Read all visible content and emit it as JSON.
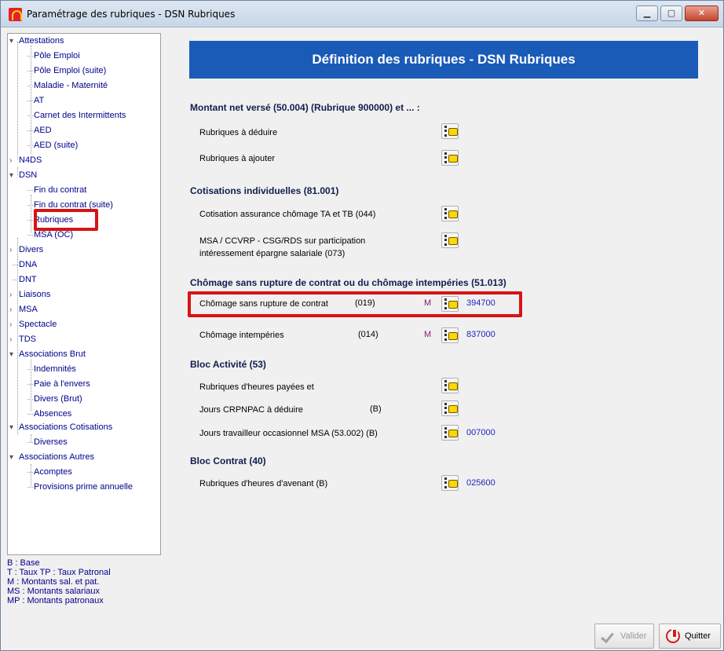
{
  "window": {
    "title": "Paramétrage des rubriques - DSN Rubriques",
    "min_icon": "minimize-icon",
    "max_icon": "maximize-icon",
    "close_icon": "close-icon"
  },
  "tree": {
    "items": [
      {
        "label": "Attestations",
        "toggle": "▾"
      },
      {
        "label": "Pôle Emploi"
      },
      {
        "label": "Pôle Emploi (suite)"
      },
      {
        "label": "Maladie - Maternité"
      },
      {
        "label": "AT"
      },
      {
        "label": "Carnet des Intermittents"
      },
      {
        "label": "AED"
      },
      {
        "label": "AED (suite)"
      },
      {
        "label": "N4DS",
        "toggle": "›"
      },
      {
        "label": "DSN",
        "toggle": "▾"
      },
      {
        "label": "Fin du contrat"
      },
      {
        "label": "Fin du contrat (suite)"
      },
      {
        "label": "Rubriques"
      },
      {
        "label": "MSA (OC)"
      },
      {
        "label": "Divers",
        "toggle": "›"
      },
      {
        "label": "DNA"
      },
      {
        "label": "DNT"
      },
      {
        "label": "Liaisons",
        "toggle": "›"
      },
      {
        "label": "MSA",
        "toggle": "›"
      },
      {
        "label": "Spectacle",
        "toggle": "›"
      },
      {
        "label": "TDS",
        "toggle": "›"
      },
      {
        "label": "Associations Brut",
        "toggle": "▾"
      },
      {
        "label": "Indemnités"
      },
      {
        "label": "Paie à l'envers"
      },
      {
        "label": "Divers (Brut)"
      },
      {
        "label": "Absences"
      },
      {
        "label": "Associations Cotisations",
        "toggle": "▾"
      },
      {
        "label": "Diverses"
      },
      {
        "label": "Associations Autres",
        "toggle": "▾"
      },
      {
        "label": "Acomptes"
      },
      {
        "label": "Provisions prime annuelle"
      }
    ]
  },
  "legend": [
    "B   : Base",
    "T   : Taux   TP : Taux Patronal",
    "M  : Montants sal. et pat.",
    "MS : Montants salariaux",
    "MP : Montants patronaux"
  ],
  "main": {
    "banner": "Définition des rubriques - DSN Rubriques",
    "sections": [
      {
        "title": "Montant net versé (50.004) (Rubrique 900000) et ... :"
      },
      {
        "title": "Cotisations individuelles (81.001)"
      },
      {
        "title": "Chômage sans rupture de contrat ou du chômage intempéries (51.013)"
      },
      {
        "title": "Bloc Activité (53)"
      },
      {
        "title": "Bloc Contrat (40)"
      }
    ],
    "rows": [
      {
        "label": "Rubriques à déduire"
      },
      {
        "label": "Rubriques à ajouter"
      },
      {
        "label": "Cotisation assurance chômage TA et TB (044)"
      },
      {
        "label": "MSA / CCVRP - CSG/RDS sur participation",
        "label2": "intéressement épargne salariale (073)"
      },
      {
        "label": "Chômage sans rupture de contrat",
        "code": "(019)",
        "flag": "M",
        "value": "394700"
      },
      {
        "label": "Chômage intempéries",
        "code": "(014)",
        "flag": "M",
        "value": "837000"
      },
      {
        "label": "Rubriques d'heures payées et"
      },
      {
        "label": "Jours CRPNPAC à déduire",
        "code": "(B)"
      },
      {
        "label": "Jours travailleur occasionnel MSA (53.002) (B)",
        "value": "007000"
      },
      {
        "label": "Rubriques d'heures d'avenant (B)",
        "value": "025600"
      }
    ]
  },
  "buttons": {
    "valider": "Valider",
    "quitter": "Quitter"
  }
}
